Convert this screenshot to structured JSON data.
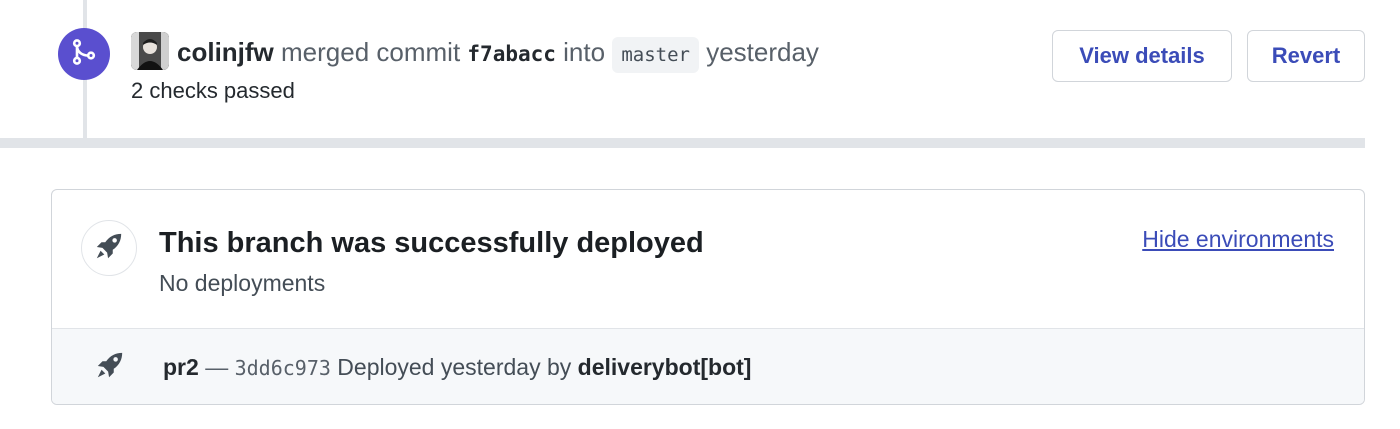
{
  "merge_event": {
    "actor": "colinjfw",
    "verb": "merged commit",
    "commit_sha": "f7abacc",
    "preposition": "into",
    "branch": "master",
    "time": "yesterday",
    "checks_status": "2 checks passed",
    "view_details_label": "View details",
    "revert_label": "Revert"
  },
  "deployment": {
    "title": "This branch was successfully deployed",
    "subtitle": "No deployments",
    "hide_environments_label": "Hide environments",
    "row": {
      "environment": "pr2",
      "separator": "—",
      "sha": "3dd6c973",
      "status": "Deployed yesterday by",
      "deployer": "deliverybot[bot]"
    }
  },
  "colors": {
    "merge_badge": "#5a4fcf",
    "link": "#3b4cb8",
    "border": "#d1d5da",
    "row_background": "#f6f8fa"
  },
  "icons": {
    "merge_badge": "git-merge-icon",
    "deploy_header": "rocket-icon",
    "deploy_row": "rocket-icon"
  }
}
